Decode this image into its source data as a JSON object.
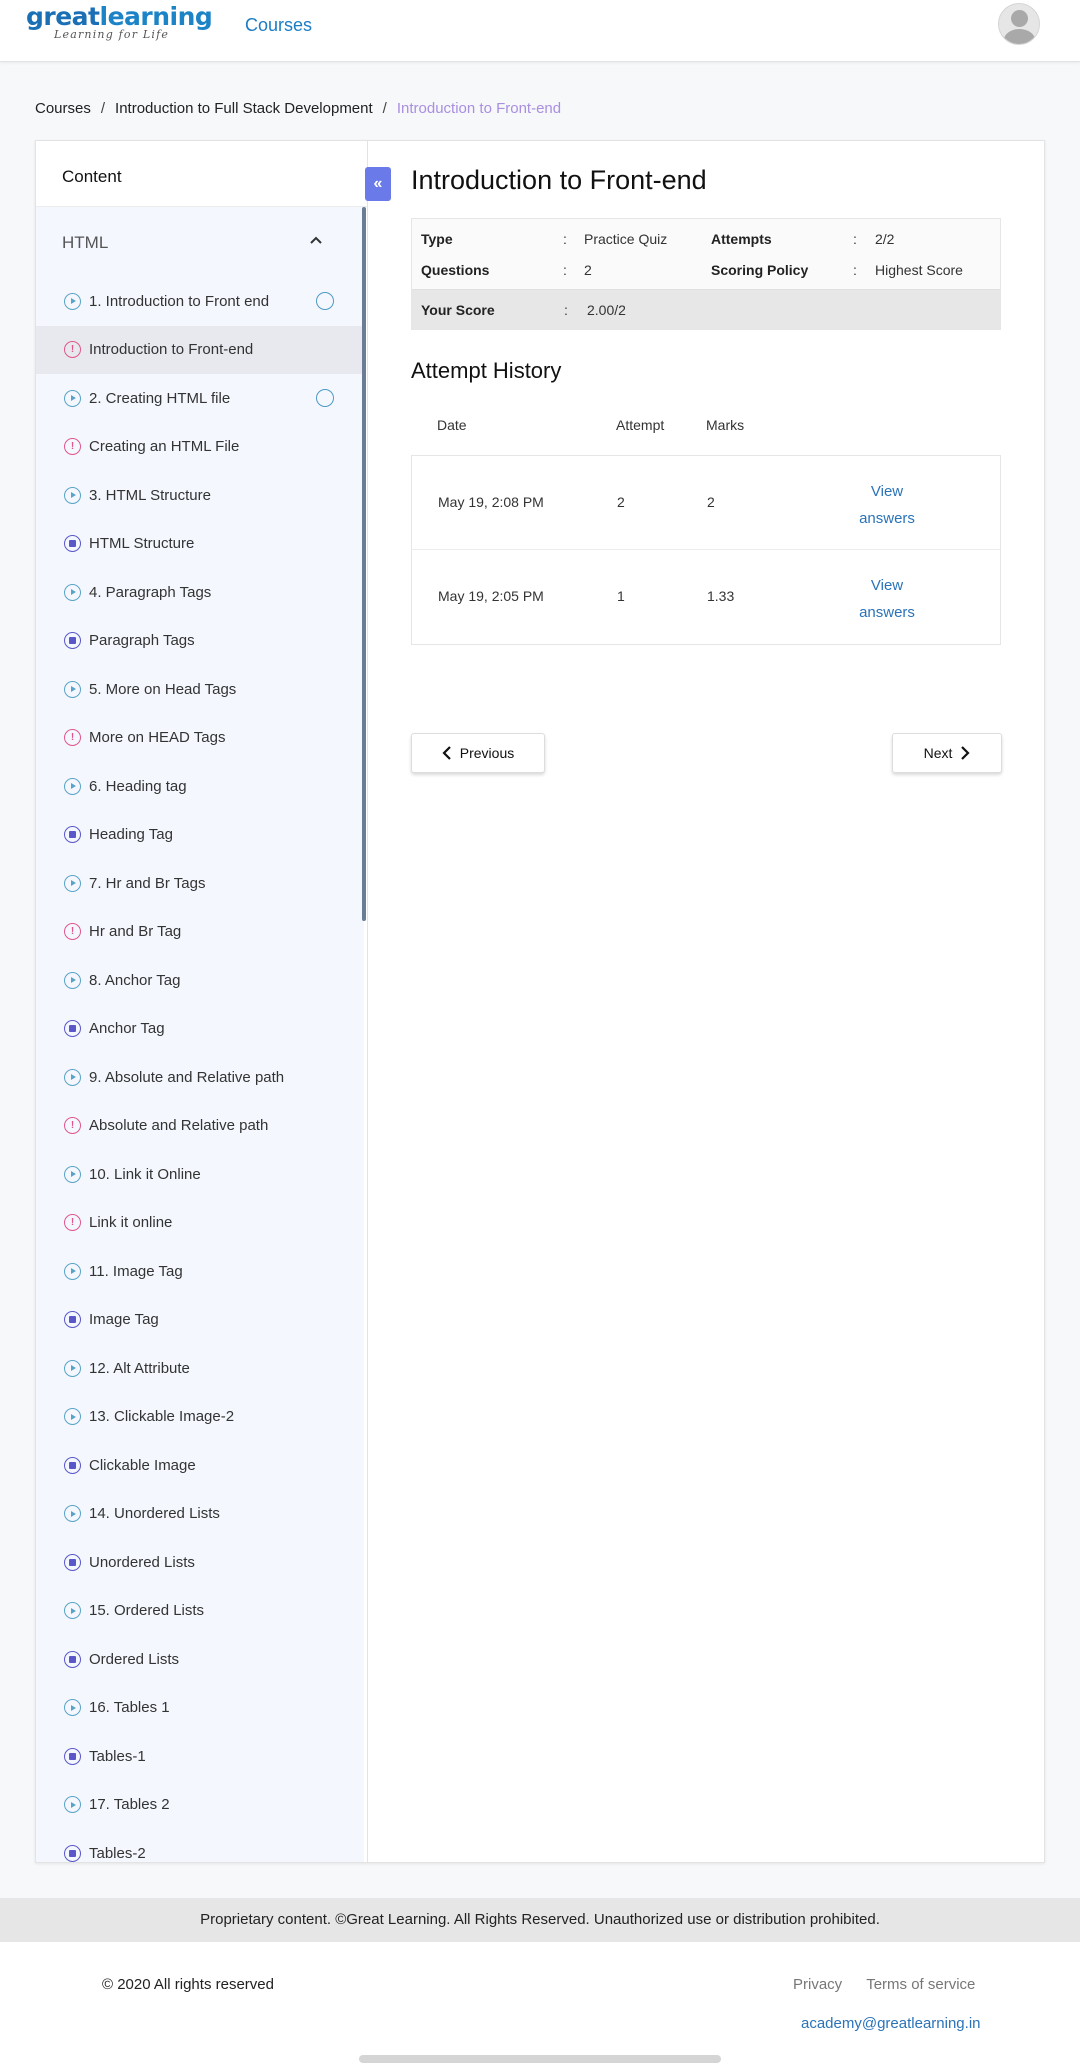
{
  "header": {
    "logo_main_a": "great",
    "logo_main_b": "learning",
    "logo_tagline": "Learning for Life",
    "nav_courses": "Courses"
  },
  "breadcrumb": {
    "items": [
      "Courses",
      "Introduction to Full Stack Development"
    ],
    "separator": "/",
    "current": "Introduction to Front-end"
  },
  "sidebar": {
    "heading": "Content",
    "section": "HTML",
    "items": [
      {
        "label": "1. Introduction to Front end",
        "icon": "play-circle-icon",
        "type": "video",
        "status": true
      },
      {
        "label": "Introduction to Front-end",
        "icon": "quiz-icon",
        "type": "quiz",
        "active": true
      },
      {
        "label": "2. Creating HTML file",
        "icon": "play-circle-icon",
        "type": "video",
        "status": true
      },
      {
        "label": "Creating an HTML File",
        "icon": "quiz-icon",
        "type": "quiz"
      },
      {
        "label": "3. HTML Structure",
        "icon": "play-circle-icon",
        "type": "video"
      },
      {
        "label": "HTML Structure",
        "icon": "document-icon",
        "type": "doc"
      },
      {
        "label": "4. Paragraph Tags",
        "icon": "play-circle-icon",
        "type": "video"
      },
      {
        "label": "Paragraph Tags",
        "icon": "document-icon",
        "type": "doc"
      },
      {
        "label": "5. More on Head Tags",
        "icon": "play-circle-icon",
        "type": "video"
      },
      {
        "label": "More on HEAD Tags",
        "icon": "quiz-icon",
        "type": "quiz"
      },
      {
        "label": "6. Heading tag",
        "icon": "play-circle-icon",
        "type": "video"
      },
      {
        "label": "Heading Tag",
        "icon": "document-icon",
        "type": "doc"
      },
      {
        "label": "7. Hr and Br Tags",
        "icon": "play-circle-icon",
        "type": "video"
      },
      {
        "label": "Hr and Br Tag",
        "icon": "quiz-icon",
        "type": "quiz"
      },
      {
        "label": "8. Anchor Tag",
        "icon": "play-circle-icon",
        "type": "video"
      },
      {
        "label": "Anchor Tag",
        "icon": "document-icon",
        "type": "doc"
      },
      {
        "label": "9. Absolute and Relative path",
        "icon": "play-circle-icon",
        "type": "video"
      },
      {
        "label": "Absolute and Relative path",
        "icon": "quiz-icon",
        "type": "quiz"
      },
      {
        "label": "10. Link it Online",
        "icon": "play-circle-icon",
        "type": "video"
      },
      {
        "label": "Link it online",
        "icon": "quiz-icon",
        "type": "quiz"
      },
      {
        "label": "11. Image Tag",
        "icon": "play-circle-icon",
        "type": "video"
      },
      {
        "label": "Image Tag",
        "icon": "document-icon",
        "type": "doc"
      },
      {
        "label": "12. Alt Attribute",
        "icon": "play-circle-icon",
        "type": "video"
      },
      {
        "label": "13. Clickable Image-2",
        "icon": "play-circle-icon",
        "type": "video"
      },
      {
        "label": "Clickable Image",
        "icon": "document-icon",
        "type": "doc"
      },
      {
        "label": "14. Unordered Lists",
        "icon": "play-circle-icon",
        "type": "video"
      },
      {
        "label": "Unordered Lists",
        "icon": "document-icon",
        "type": "doc"
      },
      {
        "label": "15. Ordered Lists",
        "icon": "play-circle-icon",
        "type": "video"
      },
      {
        "label": "Ordered Lists",
        "icon": "document-icon",
        "type": "doc"
      },
      {
        "label": "16. Tables 1",
        "icon": "play-circle-icon",
        "type": "video"
      },
      {
        "label": "Tables-1",
        "icon": "document-icon",
        "type": "doc"
      },
      {
        "label": "17. Tables 2",
        "icon": "play-circle-icon",
        "type": "video"
      },
      {
        "label": "Tables-2",
        "icon": "document-icon",
        "type": "doc"
      }
    ]
  },
  "collapse_button": "«",
  "main": {
    "title": "Introduction to Front-end",
    "info": {
      "type_label": "Type",
      "type_value": "Practice Quiz",
      "attempts_label": "Attempts",
      "attempts_value": "2/2",
      "questions_label": "Questions",
      "questions_value": "2",
      "policy_label": "Scoring Policy",
      "policy_value": "Highest Score",
      "score_label": "Your Score",
      "score_value": "2.00/2",
      "colon": ":"
    },
    "history_title": "Attempt History",
    "history_headers": {
      "date": "Date",
      "attempt": "Attempt",
      "marks": "Marks"
    },
    "history_rows": [
      {
        "date": "May 19, 2:08 PM",
        "attempt": "2",
        "marks": "2",
        "link1": "View",
        "link2": "answers"
      },
      {
        "date": "May 19, 2:05 PM",
        "attempt": "1",
        "marks": "1.33",
        "link1": "View",
        "link2": "answers"
      }
    ],
    "prev_label": "Previous",
    "next_label": "Next"
  },
  "footer": {
    "notice": "Proprietary content. ©Great Learning. All Rights Reserved. Unauthorized use or distribution prohibited.",
    "copyright": "© 2020 All rights reserved",
    "privacy": "Privacy",
    "terms": "Terms of service",
    "email": "academy@greatlearning.in"
  },
  "colors": {
    "brand_blue": "#1c84c6",
    "accent_purple": "#6a7ae8",
    "breadcrumb_current": "#a98fe0",
    "quiz_icon": "#e0578a",
    "doc_icon": "#5a57c9",
    "video_icon": "#5aa3c8"
  }
}
